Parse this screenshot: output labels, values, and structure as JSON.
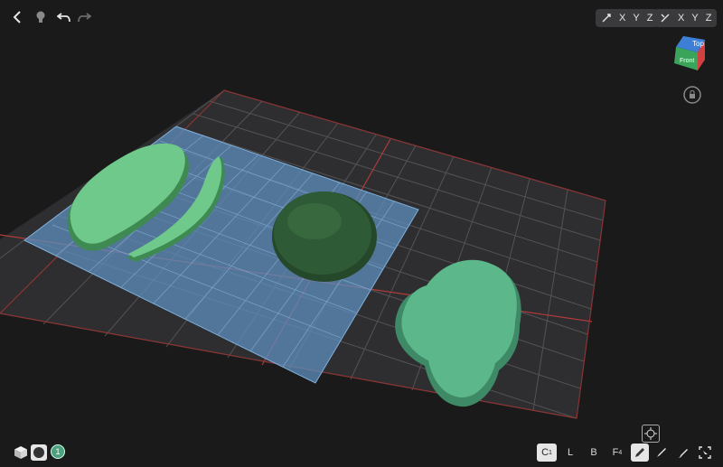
{
  "axis_groups": [
    {
      "x": "X",
      "y": "Y",
      "z": "Z"
    },
    {
      "x": "X",
      "y": "Y",
      "z": "Z"
    }
  ],
  "view_cube": {
    "top": "Top",
    "front": "Front"
  },
  "layer_badge": "1",
  "modes": [
    {
      "label": "C",
      "sub": "1",
      "active": true
    },
    {
      "label": "L",
      "sub": "",
      "active": false
    },
    {
      "label": "B",
      "sub": "",
      "active": false
    },
    {
      "label": "F",
      "sub": "4",
      "active": false
    }
  ],
  "colors": {
    "background": "#1b1a1b",
    "grid": "#5a5a5c",
    "grid_red": "#b13c3c",
    "selection_plane": "#5d8fbd",
    "voxel_light": "#6fc98a",
    "voxel_dark": "#2f5a36",
    "voxel_mint": "#5cb88a"
  }
}
